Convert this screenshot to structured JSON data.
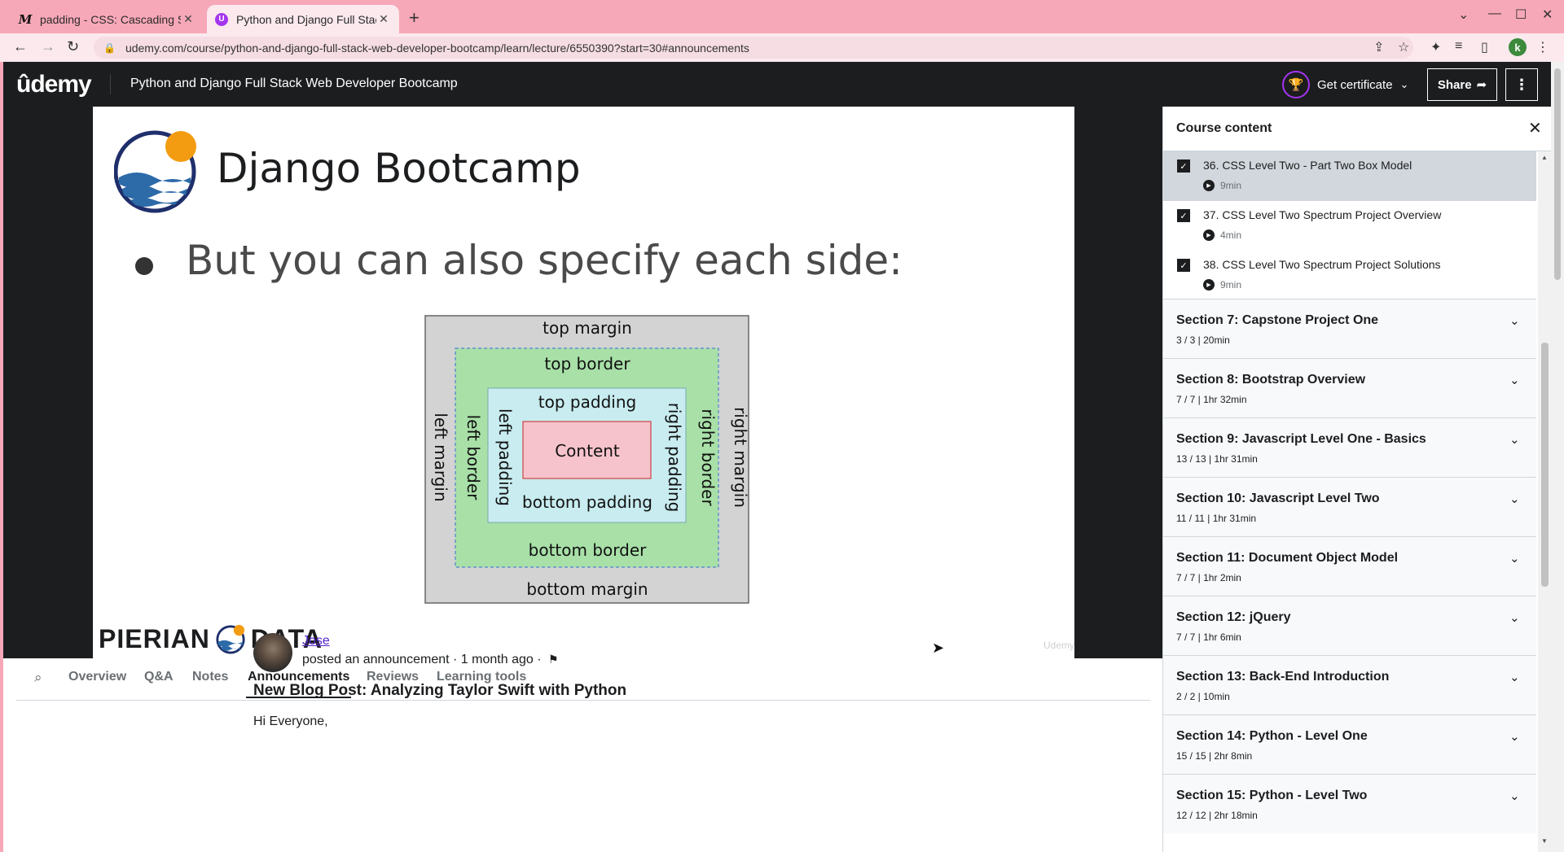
{
  "browser": {
    "tabs": [
      {
        "title": "padding - CSS: Cascading Styl",
        "favicon": "M",
        "active": false
      },
      {
        "title": "Python and Django Full Stack",
        "favicon": "U",
        "active": true
      }
    ],
    "url": "udemy.com/course/python-and-django-full-stack-web-developer-bootcamp/learn/lecture/6550390?start=30#announcements",
    "profile_initial": "k"
  },
  "header": {
    "logo": "ûdemy",
    "course_title": "Python and Django Full Stack Web Developer Bootcamp",
    "certificate_label": "Get certificate",
    "share_label": "Share"
  },
  "slide": {
    "title": "Django Bootcamp",
    "bullet": "But you can also specify each side:",
    "diagram": {
      "top_margin": "top margin",
      "top_border": "top border",
      "top_padding": "top padding",
      "content": "Content",
      "bottom_padding": "bottom padding",
      "bottom_border": "bottom border",
      "bottom_margin": "bottom margin",
      "left_margin": "left margin",
      "left_border": "left border",
      "left_padding": "left padding",
      "right_padding": "right padding",
      "right_border": "right border",
      "right_margin": "right margin",
      "colors": {
        "margin": "#d3d3d3",
        "border": "#a8e0a8",
        "padding": "#c8ecf0",
        "content": "#f6c3cc"
      }
    },
    "brand_left": "PIERIAN",
    "brand_right": "DATA",
    "watermark": "Udemy"
  },
  "content_tabs": [
    "Overview",
    "Q&A",
    "Notes",
    "Announcements",
    "Reviews",
    "Learning tools"
  ],
  "active_tab": "Announcements",
  "announcement": {
    "author": "Jose",
    "meta": "posted an announcement · 1 month ago ·",
    "title": "New Blog Post: Analyzing Taylor Swift with Python",
    "body_start": "Hi Everyone,"
  },
  "sidebar": {
    "title": "Course content",
    "lectures": [
      {
        "name": "36. CSS Level Two - Part Two Box Model",
        "duration": "9min",
        "current": true
      },
      {
        "name": "37. CSS Level Two Spectrum Project Overview",
        "duration": "4min",
        "current": false
      },
      {
        "name": "38. CSS Level Two Spectrum Project Solutions",
        "duration": "9min",
        "current": false
      }
    ],
    "sections": [
      {
        "name": "Section 7: Capstone Project One",
        "meta": "3 / 3 | 20min"
      },
      {
        "name": "Section 8: Bootstrap Overview",
        "meta": "7 / 7 | 1hr 32min"
      },
      {
        "name": "Section 9: Javascript Level One - Basics",
        "meta": "13 / 13 | 1hr 31min"
      },
      {
        "name": "Section 10: Javascript Level Two",
        "meta": "11 / 11 | 1hr 31min"
      },
      {
        "name": "Section 11: Document Object Model",
        "meta": "7 / 7 | 1hr 2min"
      },
      {
        "name": "Section 12: jQuery",
        "meta": "7 / 7 | 1hr 6min"
      },
      {
        "name": "Section 13: Back-End Introduction",
        "meta": "2 / 2 | 10min"
      },
      {
        "name": "Section 14: Python - Level One",
        "meta": "15 / 15 | 2hr 8min"
      },
      {
        "name": "Section 15: Python - Level Two",
        "meta": "12 / 12 | 2hr 18min"
      }
    ]
  }
}
